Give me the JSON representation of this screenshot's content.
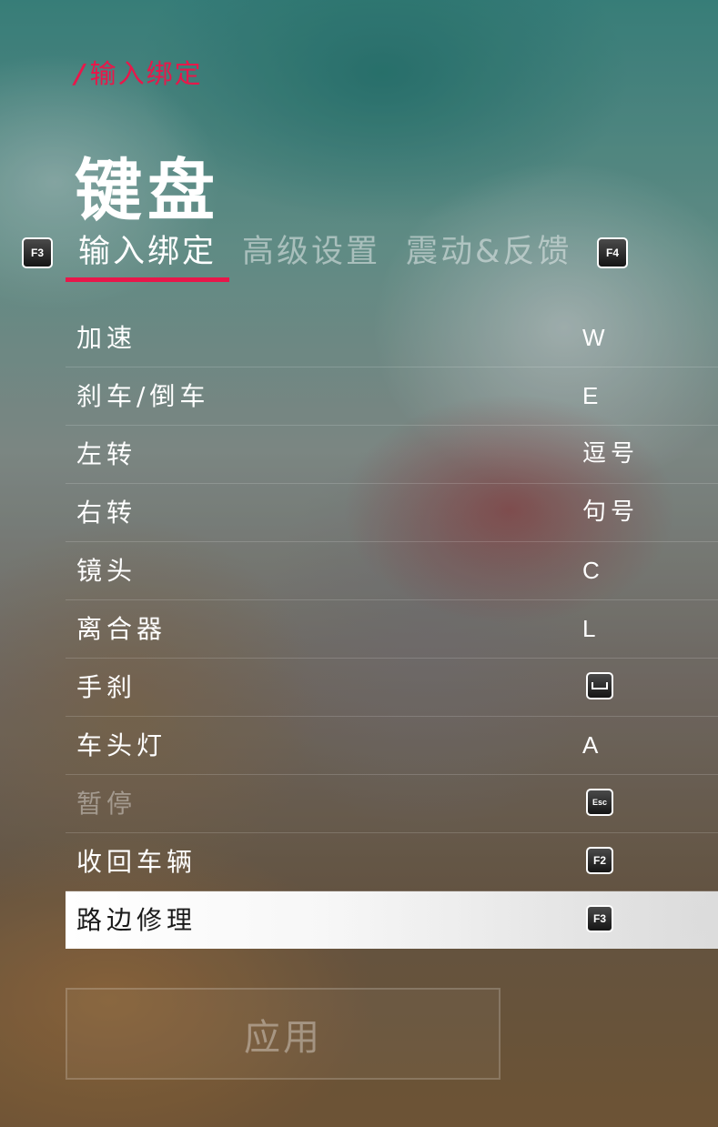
{
  "breadcrumb": {
    "slash": "/",
    "label": "输入绑定"
  },
  "title": "键盘",
  "tabs": {
    "prev_key": "F3",
    "next_key": "F4",
    "items": [
      {
        "label": "输入绑定",
        "active": true
      },
      {
        "label": "高级设置",
        "active": false
      },
      {
        "label": "震动&反馈",
        "active": false
      }
    ]
  },
  "bindings": [
    {
      "action": "加速",
      "key": "W",
      "key_type": "text"
    },
    {
      "action": "刹车/倒车",
      "key": "E",
      "key_type": "text"
    },
    {
      "action": "左转",
      "key": "逗号",
      "key_type": "text"
    },
    {
      "action": "右转",
      "key": "句号",
      "key_type": "text"
    },
    {
      "action": "镜头",
      "key": "C",
      "key_type": "text"
    },
    {
      "action": "离合器",
      "key": "L",
      "key_type": "text"
    },
    {
      "action": "手刹",
      "key": "space-key-icon",
      "key_type": "icon"
    },
    {
      "action": "车头灯",
      "key": "A",
      "key_type": "text"
    },
    {
      "action": "暂停",
      "key": "Esc",
      "key_type": "badge",
      "disabled": true
    },
    {
      "action": "收回车辆",
      "key": "F2",
      "key_type": "badge"
    },
    {
      "action": "路边修理",
      "key": "F3",
      "key_type": "badge",
      "selected": true
    }
  ],
  "apply_button": {
    "label": "应用"
  },
  "colors": {
    "accent": "#e8174a",
    "text": "#ffffff",
    "selected_row_bg": "#f3f3f3"
  }
}
